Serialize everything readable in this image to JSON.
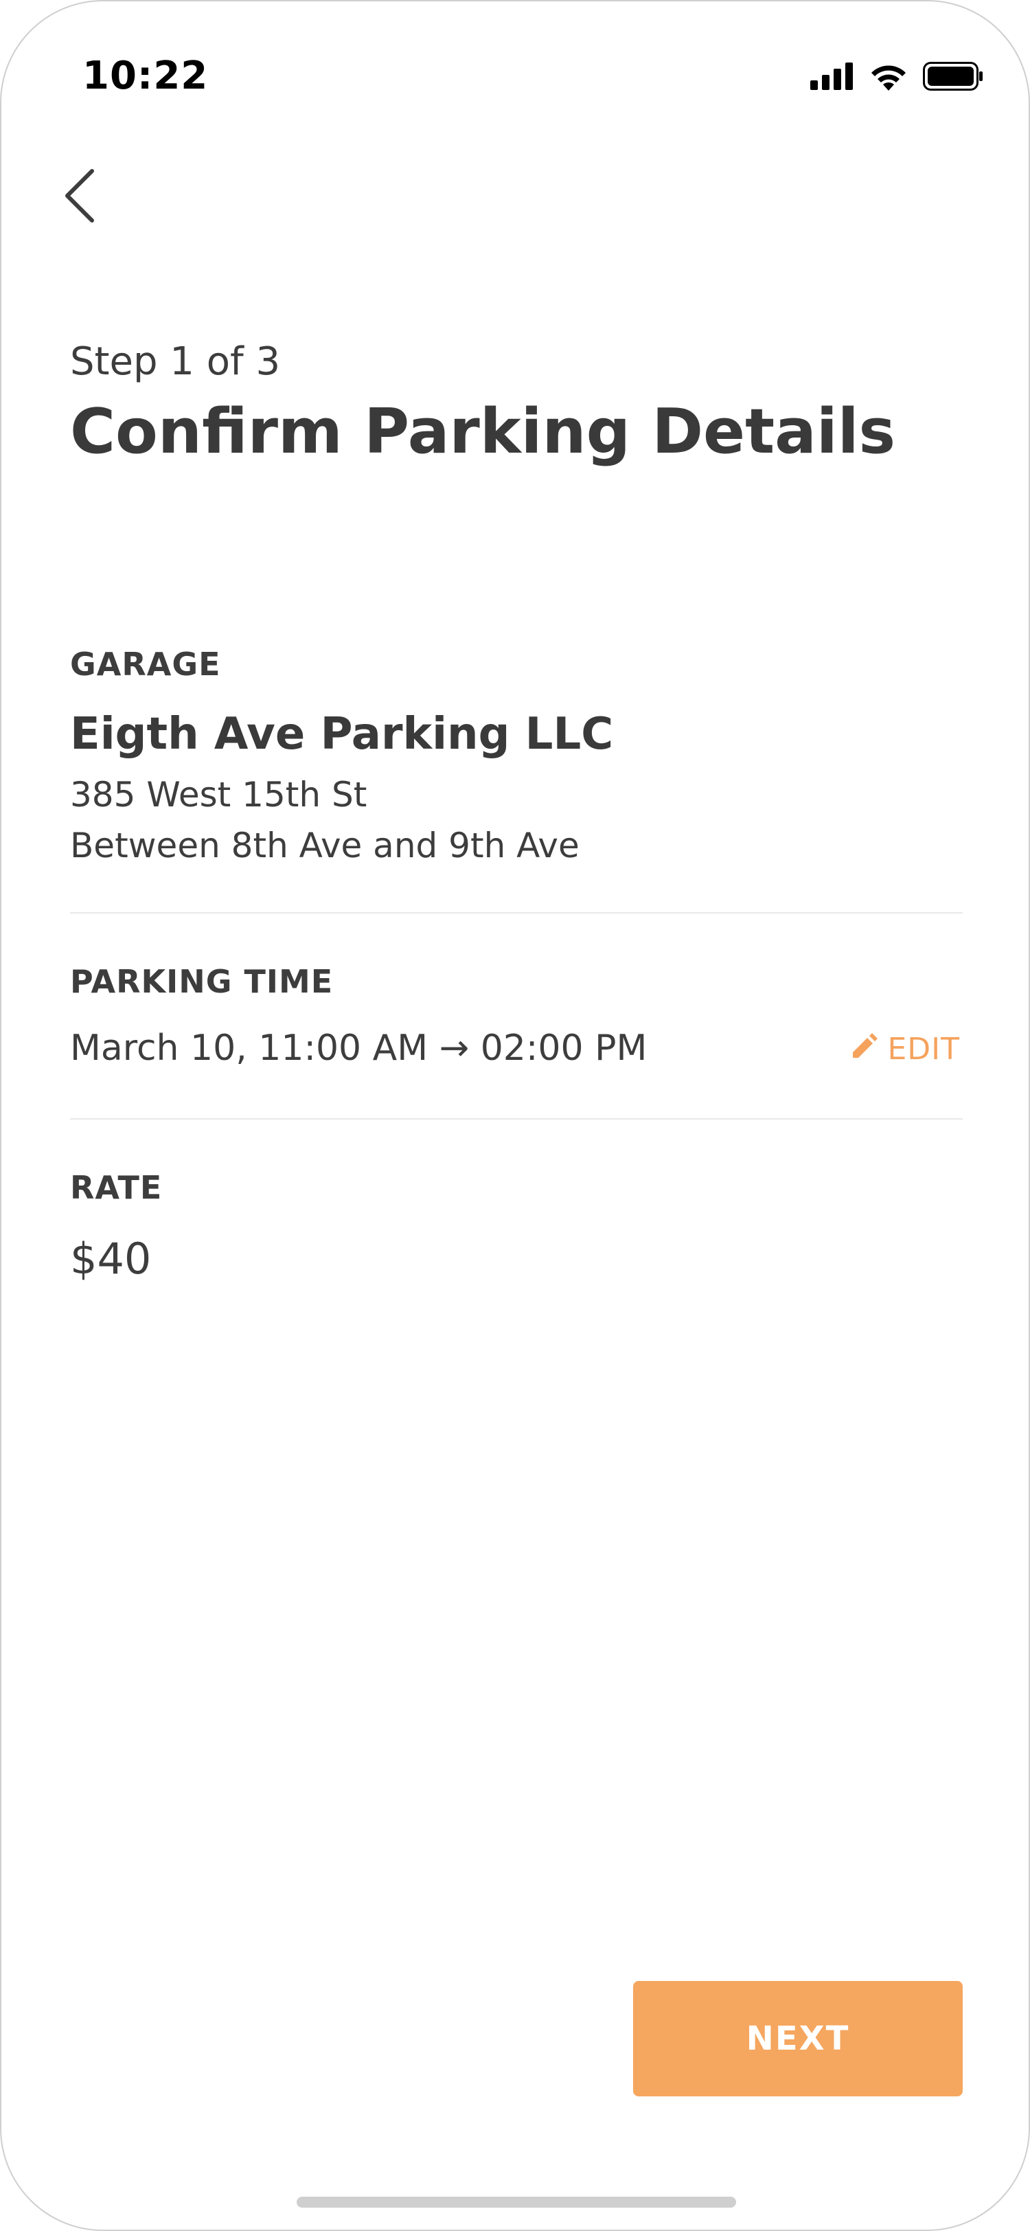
{
  "status_bar": {
    "time": "10:22",
    "icons": [
      "cellular-signal-icon",
      "wifi-icon",
      "battery-icon"
    ]
  },
  "nav": {
    "back_icon": "chevron-left-icon"
  },
  "header": {
    "step": "Step 1 of 3",
    "title": "Confirm Parking Details"
  },
  "garage": {
    "label": "GARAGE",
    "name": "Eigth Ave Parking LLC",
    "address": "385 West 15th St",
    "cross_streets": "Between 8th Ave and 9th Ave"
  },
  "parking_time": {
    "label": "PARKING TIME",
    "value": "March 10, 11:00 AM → 02:00 PM",
    "edit_label": "EDIT",
    "edit_icon": "pencil-icon"
  },
  "rate": {
    "label": "RATE",
    "value": "$40"
  },
  "footer": {
    "next_label": "NEXT"
  },
  "colors": {
    "accent": "#f5a65f",
    "text": "#3d3d3d",
    "divider": "#e8e8e8"
  }
}
